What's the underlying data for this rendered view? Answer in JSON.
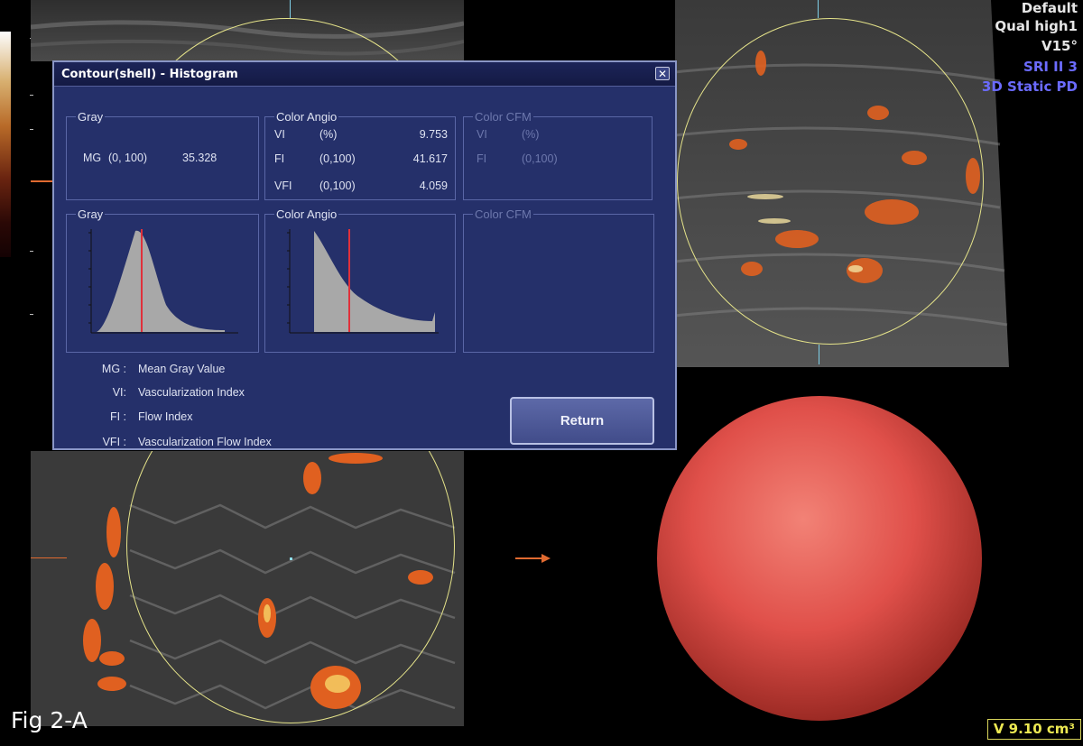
{
  "dialog": {
    "title": "Contour(shell) - Histogram",
    "gray_stats": {
      "label": "Gray",
      "mg_label": "MG",
      "mg_range": "(0, 100)",
      "mg_value": "35.328"
    },
    "angio_stats": {
      "label": "Color Angio",
      "rows": [
        {
          "name": "VI",
          "unit": "(%)",
          "value": "9.753"
        },
        {
          "name": "FI",
          "unit": "(0,100)",
          "value": "41.617"
        },
        {
          "name": "VFI",
          "unit": "(0,100)",
          "value": "4.059"
        }
      ]
    },
    "cfm_stats": {
      "label": "Color CFM",
      "rows": [
        {
          "name": "VI",
          "unit": "(%)"
        },
        {
          "name": "FI",
          "unit": "(0,100)"
        }
      ]
    },
    "gray_hist_label": "Gray",
    "angio_hist_label": "Color Angio",
    "cfm_hist_label": "Color CFM",
    "legend": [
      {
        "key": "MG :",
        "text": "Mean Gray Value"
      },
      {
        "key": "VI:",
        "text": "Vascularization Index"
      },
      {
        "key": "FI :",
        "text": "Flow Index"
      },
      {
        "key": "VFI :",
        "text": "Vascularization Flow Index"
      }
    ],
    "return_label": "Return"
  },
  "status": {
    "lines": [
      "Default",
      "Qual high1",
      "V15°",
      "SRI II 3",
      "3D Static PD"
    ],
    "white_color": "#e6e6e6",
    "blue_color": "#6b6bff"
  },
  "figure_label": "Fig 2-A",
  "volume_readout": "V 9.10 cm³",
  "render_color": "#e0504a"
}
